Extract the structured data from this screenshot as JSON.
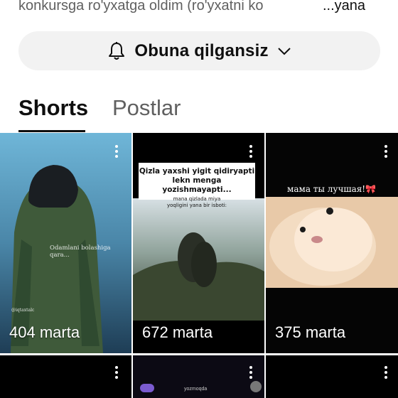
{
  "description": {
    "text": "konkursga ro'yxatga oldim (ro'yxatni ko",
    "more": "...yana"
  },
  "subscribe": {
    "label": "Obuna qilgansiz",
    "icon": "bell-icon",
    "dropdown_icon": "chevron-down-icon"
  },
  "tabs": [
    {
      "label": "Shorts",
      "active": true
    },
    {
      "label": "Postlar",
      "active": false
    }
  ],
  "shorts": [
    {
      "views": "404 marta",
      "overlay": "Odamlani bolashiga qara...",
      "watermark": "@iqtaxtalc"
    },
    {
      "views": "672 marta",
      "caption_line1": "Qizla yaxshi yigit qidiryapti",
      "caption_line2": "lekn menga yozishmayapti...",
      "caption_line3": "mana qizlada miya",
      "caption_line4": "yoqligini yana bir isboti:"
    },
    {
      "views": "375 marta",
      "caption": "мама ты лучшая!🎀"
    }
  ],
  "row2": {
    "tile2_text": "yozmoqda"
  },
  "colors": {
    "accent": "#0f0f0f",
    "muted": "#606060",
    "button_bg": "#f2f2f2"
  }
}
